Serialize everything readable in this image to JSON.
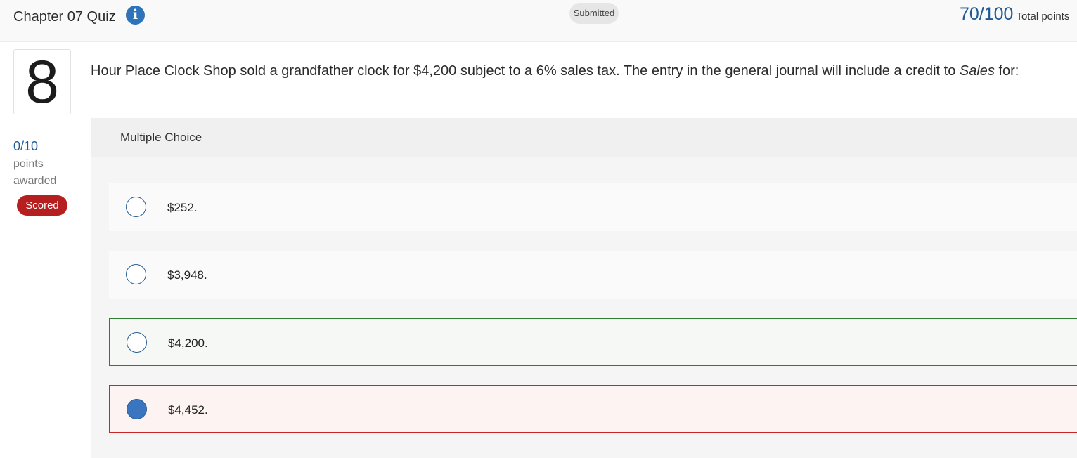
{
  "header": {
    "title": "Chapter 07 Quiz",
    "info_icon": "i",
    "status": "Submitted",
    "score": "70/100",
    "score_label": "Total points"
  },
  "question": {
    "number": "8",
    "points": "0/10",
    "points_label": "points awarded",
    "badge": "Scored",
    "text_before": "Hour Place Clock Shop sold a grandfather clock for $4,200 subject to a 6% sales tax. The entry in the general journal will include a credit to ",
    "text_emphasis": "Sales",
    "text_after": " for:",
    "type_label": "Multiple Choice"
  },
  "options": [
    {
      "label": "$252.",
      "selected": false,
      "state": "neutral"
    },
    {
      "label": "$3,948.",
      "selected": false,
      "state": "neutral"
    },
    {
      "label": "$4,200.",
      "selected": false,
      "state": "correct"
    },
    {
      "label": "$4,452.",
      "selected": true,
      "state": "incorrect"
    }
  ],
  "colors": {
    "accent": "#1f5a95",
    "scored_badge": "#b51f1f",
    "correct_border": "#2e7d32",
    "incorrect_border": "#c62828",
    "selected_radio": "#3a76bf"
  }
}
